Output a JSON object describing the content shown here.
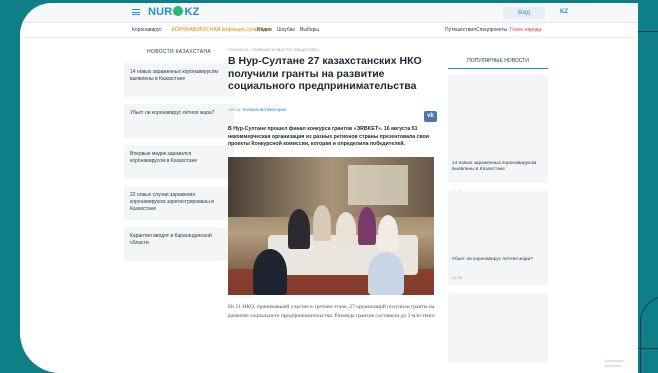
{
  "header": {
    "logo_text": "NUR",
    "logo_suffix": "KZ",
    "login_label": "Вxiд",
    "lang_label": "KZ"
  },
  "nav": {
    "items": [
      {
        "label": "Коронавирус"
      },
      {
        "label": "КОРОНАВИРУСНАЯ инфекция Jysan Bank"
      },
      {
        "label": "Видео"
      },
      {
        "label": "Шоубиз"
      },
      {
        "label": "Выборы"
      }
    ],
    "right_items": [
      {
        "label": "Путешествия"
      },
      {
        "label": "Спецпроекты"
      },
      {
        "label": "Голос народа"
      }
    ]
  },
  "left_sidebar": {
    "heading": "НОВОСТИ КАЗАХСТАНА",
    "items": [
      {
        "text": "14 новых зараженных коронавирусом выявлены в Казахстане"
      },
      {
        "text": "Убьет ли коронавирус летняя жара?"
      },
      {
        "text": "Впервые медик заразился коронавирусом в Казахстане"
      },
      {
        "text": "22 новых случая заражения коронавирусом зарегистрированы в Казахстане"
      },
      {
        "text": "Карантин вводят в Карагандинской области"
      }
    ]
  },
  "article": {
    "breadcrumbs": "2019 08 19 · ГЛАВНЫЕ НОВОСТИ / ОБЩЕСТВО",
    "title": "В Нур-Султане 27 казахстанских НКО получили гранты на развитие социального предпринимательства",
    "author_label": "Автор:",
    "author_name": "Копжанова Виктория",
    "share_label": "vk",
    "lead": "В Нур-Султане прошел финал конкурса грантов «ЭRBKET». 16 августа 51 некоммерческая организация из разных регионов страны презентовала свои проекты Конкурсной комиссии, которая и определила победителей.",
    "body": "Из 51 НКО, принимавшей участие в третьем этапе, 27 организаций получили гранты на развитие социального предпринимательства. Размеры грантов составили до 3 млн тенге"
  },
  "right_sidebar": {
    "heading": "ПОПУЛЯРНЫЕ НОВОСТИ",
    "cards": [
      {
        "text": "14 новых зараженных коронавирусом выявлены в Казахстане",
        "time": "14:40"
      },
      {
        "text": "Убьет ли коронавирус летняя жара?",
        "time": "12:46"
      },
      {
        "text": "",
        "time": ""
      }
    ]
  },
  "watermark": "Активация Windows",
  "colors": {
    "accent": "#1f8fd1",
    "background": "#0f7f87",
    "logo_dot": "#2bb673"
  }
}
